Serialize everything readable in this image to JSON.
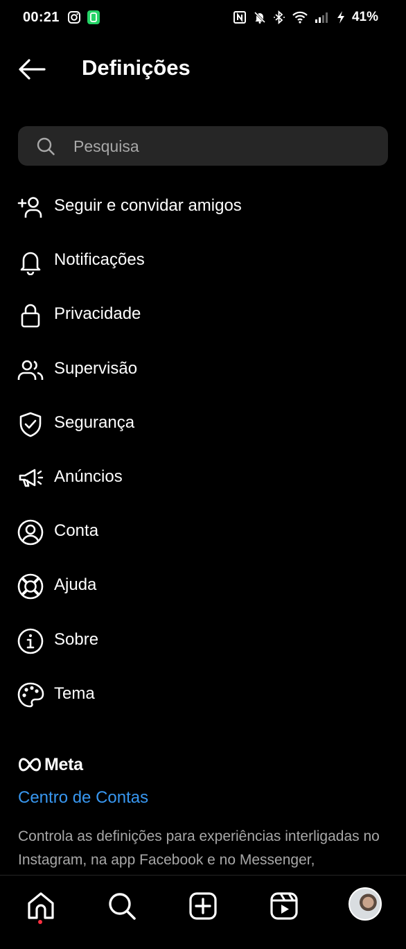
{
  "status_bar": {
    "time": "00:21",
    "battery": "41%"
  },
  "header": {
    "title": "Definições"
  },
  "search": {
    "placeholder": "Pesquisa",
    "value": ""
  },
  "menu": [
    {
      "label": "Seguir e convidar amigos",
      "icon": "add-person-icon"
    },
    {
      "label": "Notificações",
      "icon": "bell-icon"
    },
    {
      "label": "Privacidade",
      "icon": "lock-icon"
    },
    {
      "label": "Supervisão",
      "icon": "people-icon"
    },
    {
      "label": "Segurança",
      "icon": "shield-icon"
    },
    {
      "label": "Anúncios",
      "icon": "megaphone-icon"
    },
    {
      "label": "Conta",
      "icon": "account-circle-icon"
    },
    {
      "label": "Ajuda",
      "icon": "lifebuoy-icon"
    },
    {
      "label": "Sobre",
      "icon": "info-icon"
    },
    {
      "label": "Tema",
      "icon": "palette-icon"
    }
  ],
  "meta": {
    "logo_text": "Meta",
    "accounts_center": "Centro de Contas",
    "description": "Controla as definições para experiências interligadas no Instagram, na app Facebook e no Messenger,"
  },
  "bottom_nav": [
    "home-icon",
    "search-icon",
    "create-icon",
    "reels-icon",
    "profile-avatar"
  ],
  "colors": {
    "background": "#000000",
    "search_bg": "#262626",
    "link": "#3897f0",
    "secondary_text": "#a8a8a8",
    "notification_dot": "#ff3040"
  }
}
